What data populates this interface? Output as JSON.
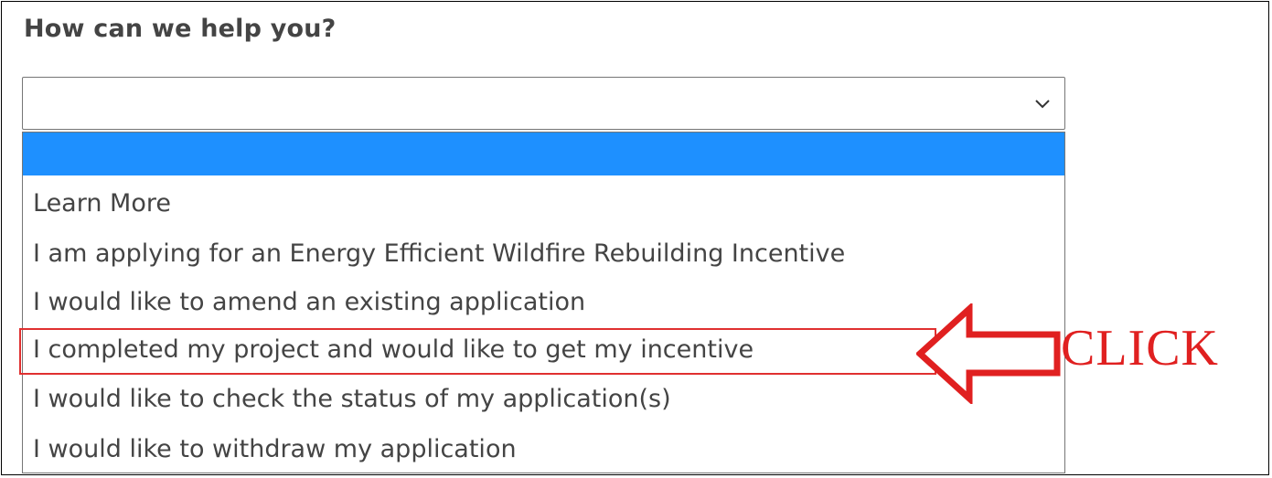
{
  "form": {
    "question": "How can we help you?",
    "select_value": "",
    "options": [
      "",
      "Learn More",
      "I am applying for an Energy Efficient Wildfire Rebuilding Incentive",
      "I would like to amend an existing application",
      "I completed my project and would like to get my incentive",
      "I would like to check the status of my application(s)",
      "I would like to withdraw my application"
    ],
    "highlighted_option_index": 0
  },
  "annotation": {
    "label": "CLICK",
    "target_option_index": 4,
    "color": "#e02020"
  },
  "icons": {
    "select_indicator": "chevron-down-icon",
    "annotation_pointer": "left-arrow-icon"
  },
  "colors": {
    "highlight": "#1e90ff",
    "text": "#444444",
    "annotation": "#e02020"
  }
}
